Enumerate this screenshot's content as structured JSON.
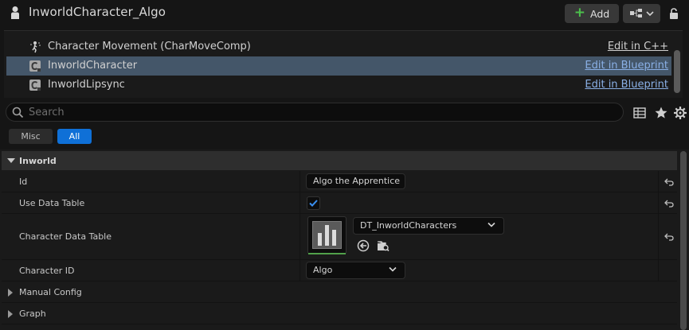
{
  "title_bar": {
    "title": "InworldCharacter_Algo",
    "add_label": "Add"
  },
  "components": [
    {
      "label": "Character Movement (CharMoveComp)",
      "link": "Edit in C++",
      "icon": "character-movement-icon"
    },
    {
      "label": "InworldCharacter",
      "link": "Edit in Blueprint",
      "icon": "class-c-icon",
      "selected": true
    },
    {
      "label": "InworldLipsync",
      "link": "Edit in Blueprint",
      "icon": "class-c-icon"
    }
  ],
  "search": {
    "placeholder": "Search"
  },
  "filter_tabs": {
    "misc": "Misc",
    "all": "All",
    "active": "All"
  },
  "details": {
    "category": "Inworld",
    "props": {
      "id": {
        "name": "Id",
        "value": "Algo the Apprentice"
      },
      "use_data_table": {
        "name": "Use Data Table",
        "checked": true
      },
      "character_data_table": {
        "name": "Character Data Table",
        "value": "DT_InworldCharacters"
      },
      "character_id": {
        "name": "Character ID",
        "value": "Algo"
      }
    },
    "collapsed": [
      "Manual Config",
      "Graph"
    ]
  },
  "colors": {
    "accent_blue": "#0f70d7",
    "selection": "#445669",
    "link_blue": "#8ab0e6",
    "add_green": "#4cc14c"
  }
}
